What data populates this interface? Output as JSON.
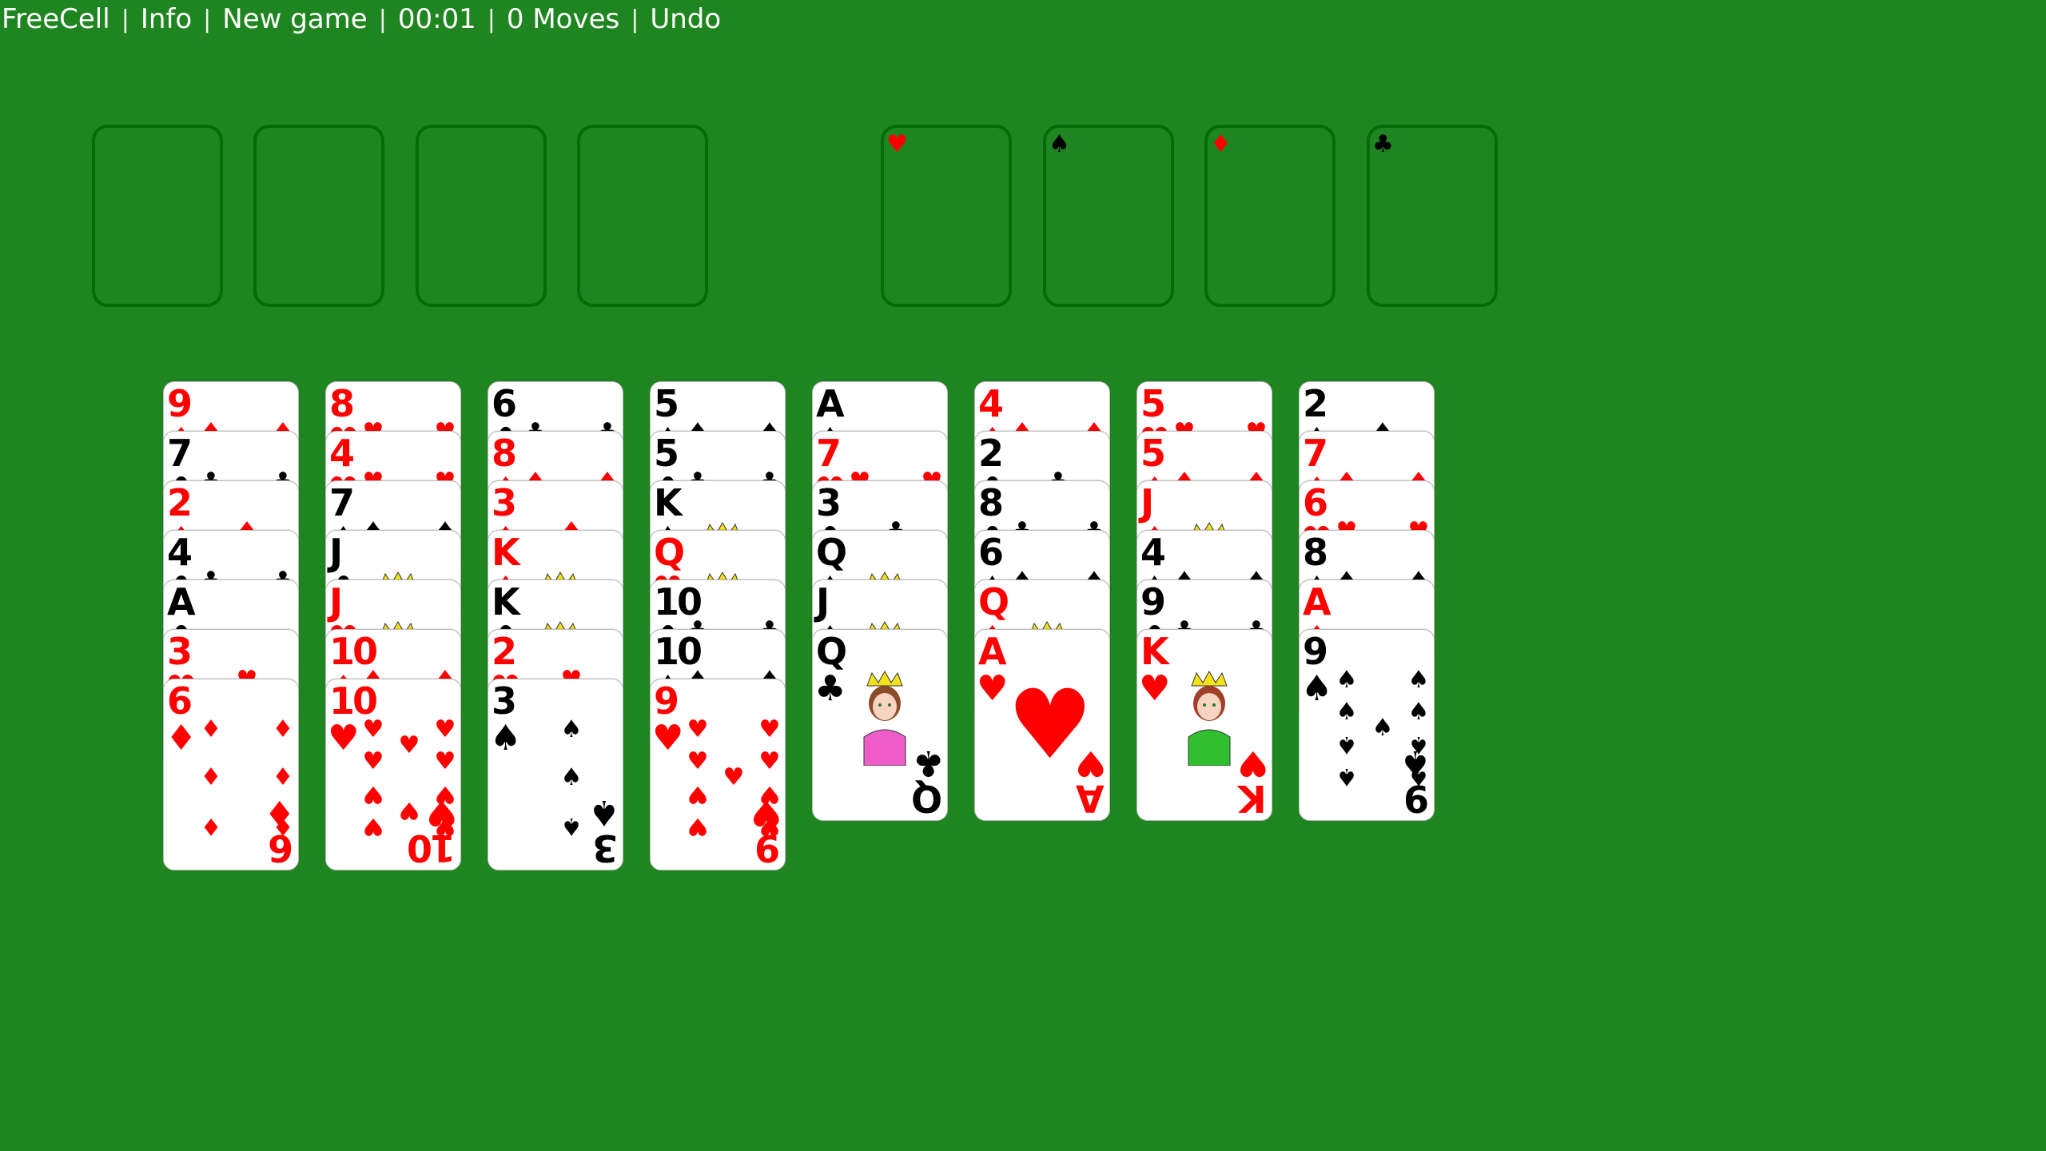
{
  "topbar": {
    "title": "FreeCell",
    "info": "Info",
    "new_game": "New game",
    "timer": "00:01",
    "moves": "0 Moves",
    "undo": "Undo",
    "separator": "|"
  },
  "colors": {
    "table": "#1f8520",
    "slot_border": "#056b05",
    "red_suit": "#ff0000",
    "black_suit": "#000000"
  },
  "free_cells": [
    {
      "card": null
    },
    {
      "card": null
    },
    {
      "card": null
    },
    {
      "card": null
    }
  ],
  "foundations": [
    {
      "suit": "hearts",
      "symbol": "♥",
      "color": "red",
      "card": null
    },
    {
      "suit": "spades",
      "symbol": "♠",
      "color": "black",
      "card": null
    },
    {
      "suit": "diamonds",
      "symbol": "♦",
      "color": "red",
      "card": null
    },
    {
      "suit": "clubs",
      "symbol": "♣",
      "color": "black",
      "card": null
    }
  ],
  "tableau": [
    {
      "cards": [
        {
          "rank": "9",
          "suit": "♦"
        },
        {
          "rank": "7",
          "suit": "♣"
        },
        {
          "rank": "2",
          "suit": "♦"
        },
        {
          "rank": "4",
          "suit": "♣"
        },
        {
          "rank": "A",
          "suit": "♣"
        },
        {
          "rank": "3",
          "suit": "♥"
        },
        {
          "rank": "6",
          "suit": "♦"
        }
      ]
    },
    {
      "cards": [
        {
          "rank": "8",
          "suit": "♥"
        },
        {
          "rank": "4",
          "suit": "♥"
        },
        {
          "rank": "7",
          "suit": "♠"
        },
        {
          "rank": "J",
          "suit": "♣"
        },
        {
          "rank": "J",
          "suit": "♥"
        },
        {
          "rank": "10",
          "suit": "♦"
        },
        {
          "rank": "10",
          "suit": "♥"
        }
      ]
    },
    {
      "cards": [
        {
          "rank": "6",
          "suit": "♣"
        },
        {
          "rank": "8",
          "suit": "♦"
        },
        {
          "rank": "3",
          "suit": "♦"
        },
        {
          "rank": "K",
          "suit": "♦"
        },
        {
          "rank": "K",
          "suit": "♣"
        },
        {
          "rank": "2",
          "suit": "♥"
        },
        {
          "rank": "3",
          "suit": "♠"
        }
      ]
    },
    {
      "cards": [
        {
          "rank": "5",
          "suit": "♠"
        },
        {
          "rank": "5",
          "suit": "♣"
        },
        {
          "rank": "K",
          "suit": "♠"
        },
        {
          "rank": "Q",
          "suit": "♥"
        },
        {
          "rank": "10",
          "suit": "♣"
        },
        {
          "rank": "10",
          "suit": "♠"
        },
        {
          "rank": "9",
          "suit": "♥"
        }
      ]
    },
    {
      "cards": [
        {
          "rank": "A",
          "suit": "♠"
        },
        {
          "rank": "7",
          "suit": "♥"
        },
        {
          "rank": "3",
          "suit": "♣"
        },
        {
          "rank": "Q",
          "suit": "♠"
        },
        {
          "rank": "J",
          "suit": "♠"
        },
        {
          "rank": "Q",
          "suit": "♣"
        }
      ]
    },
    {
      "cards": [
        {
          "rank": "4",
          "suit": "♦"
        },
        {
          "rank": "2",
          "suit": "♣"
        },
        {
          "rank": "8",
          "suit": "♣"
        },
        {
          "rank": "6",
          "suit": "♠"
        },
        {
          "rank": "Q",
          "suit": "♦"
        },
        {
          "rank": "A",
          "suit": "♥"
        }
      ]
    },
    {
      "cards": [
        {
          "rank": "5",
          "suit": "♥"
        },
        {
          "rank": "5",
          "suit": "♦"
        },
        {
          "rank": "J",
          "suit": "♦"
        },
        {
          "rank": "4",
          "suit": "♠"
        },
        {
          "rank": "9",
          "suit": "♣"
        },
        {
          "rank": "K",
          "suit": "♥"
        }
      ]
    },
    {
      "cards": [
        {
          "rank": "2",
          "suit": "♠"
        },
        {
          "rank": "7",
          "suit": "♦"
        },
        {
          "rank": "6",
          "suit": "♥"
        },
        {
          "rank": "8",
          "suit": "♠"
        },
        {
          "rank": "A",
          "suit": "♦"
        },
        {
          "rank": "9",
          "suit": "♠"
        }
      ]
    }
  ]
}
